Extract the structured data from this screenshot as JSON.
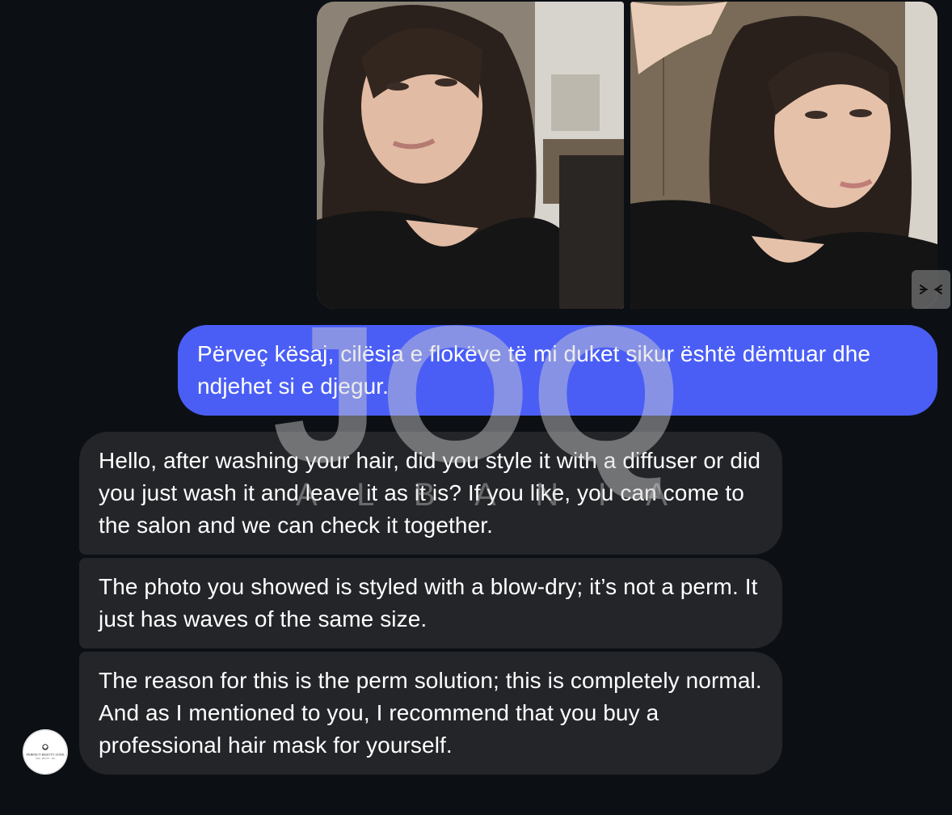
{
  "attachments": {
    "photo_1": {
      "icon": "photo-image"
    },
    "photo_2": {
      "icon": "photo-image"
    },
    "collapse_icon": "collapse-arrows-icon"
  },
  "messages": [
    {
      "sender": "me",
      "text": "Përveç kësaj, cilësia e flokëve të mi duket sikur është dëmtuar dhe ndjehet si e djegur."
    },
    {
      "sender": "salon",
      "text": "Hello, after washing your hair, did you style it with a diffuser or did you just wash it and leave it as it is? If you like, you can come to the salon and we can check it together."
    },
    {
      "sender": "salon",
      "text": "The photo you showed is styled with a blow-dry; it’s not a perm. It just has waves of the same size."
    },
    {
      "sender": "salon",
      "text": "The reason for this is the perm solution; this is completely normal. And as I mentioned to you, I recommend that you buy a professional hair mask for yourself."
    }
  ],
  "avatar": {
    "logo_text": "PERFECT BEAUTY ZONE",
    "logo_subtext": "HAIR · BEAUTY · SPA"
  },
  "watermark": {
    "logo": "JOQ",
    "subtitle": [
      "A",
      "L",
      "B",
      "A",
      "N",
      "I",
      "A"
    ]
  },
  "colors": {
    "background": "#0c1015",
    "outgoing_bubble": "#4a5ef5",
    "incoming_bubble": "#232529",
    "text": "#ffffff"
  }
}
